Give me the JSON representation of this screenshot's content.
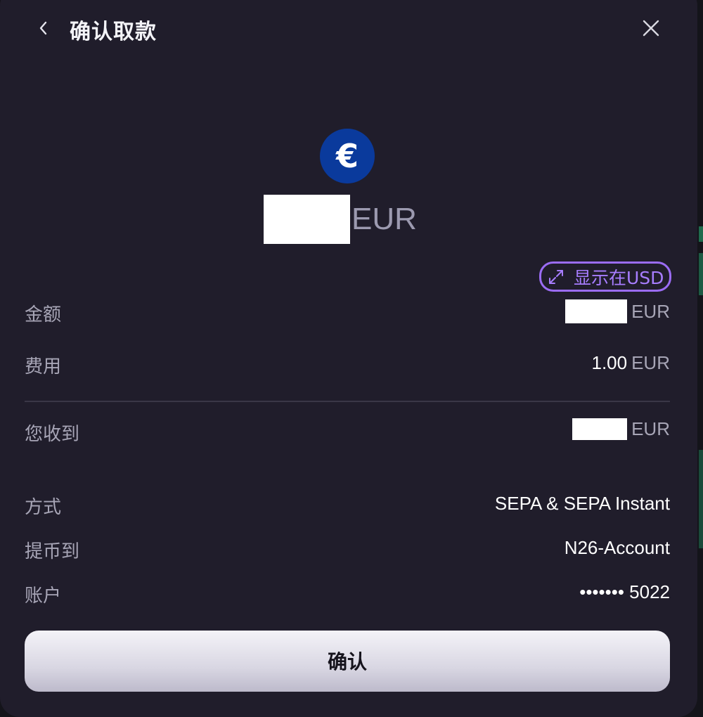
{
  "modal": {
    "title": "确认取款"
  },
  "amount": {
    "currency": "EUR",
    "currency_symbol": "€",
    "icon_color": "#0a3a9c"
  },
  "toggle": {
    "label": "显示在USD",
    "accent": "#9b6cf5"
  },
  "details": {
    "amount_label": "金额",
    "amount_unit": "EUR",
    "fee_label": "费用",
    "fee_value": "1.00",
    "fee_unit": "EUR",
    "receive_label": "您收到",
    "receive_unit": "EUR",
    "method_label": "方式",
    "method_value": "SEPA & SEPA Instant",
    "withdraw_to_label": "提币到",
    "withdraw_to_value": "N26-Account",
    "account_label": "账户",
    "account_value": "••••••• 5022"
  },
  "confirm_button": {
    "label": "确认"
  }
}
